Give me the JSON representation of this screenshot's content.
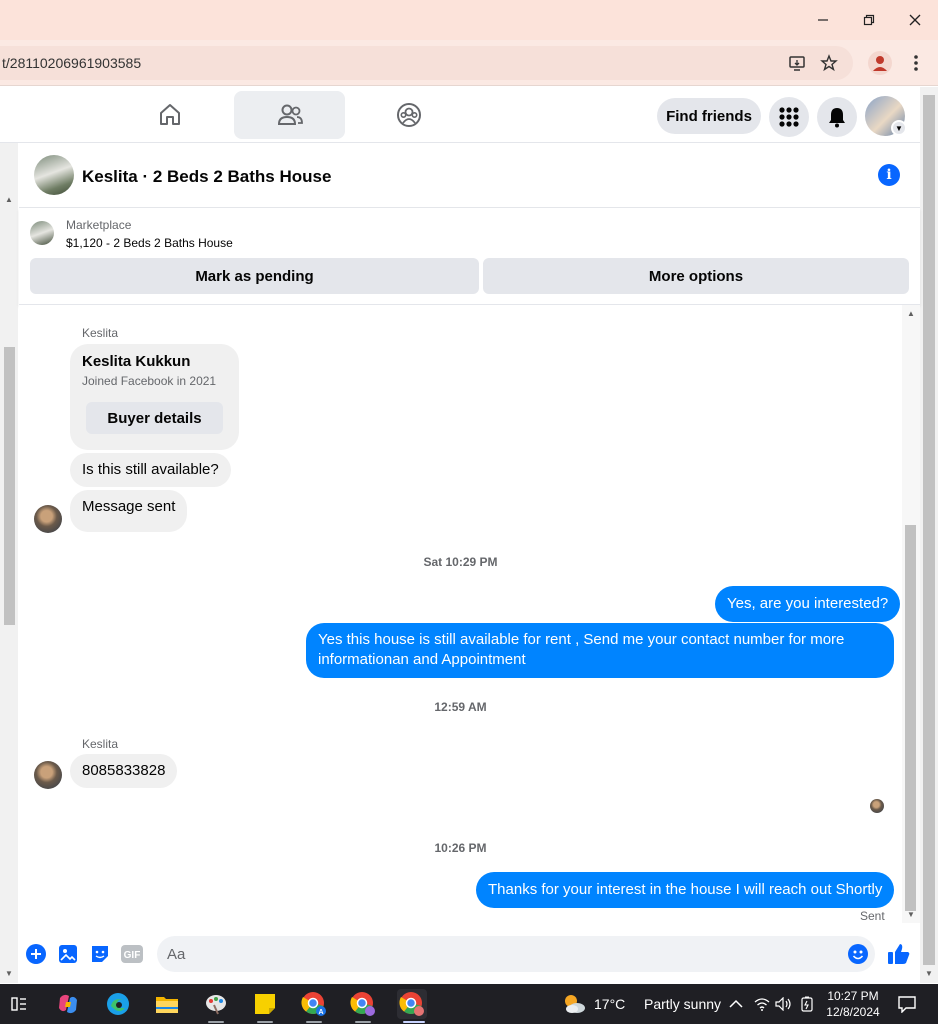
{
  "browser": {
    "url_fragment": "t/28110206961903585",
    "window_controls": {
      "minimize_icon": "minimize-icon",
      "restore_icon": "restore-icon",
      "close_icon": "close-icon"
    }
  },
  "fb_nav": {
    "find_friends_label": "Find friends",
    "active_tab": "friends"
  },
  "chat": {
    "title": "Keslita · 2 Beds 2 Baths House",
    "listing": {
      "kind": "Marketplace",
      "price_line": "$1,120 - 2 Beds 2 Baths House",
      "mark_pending_label": "Mark as pending",
      "more_options_label": "More options"
    },
    "buyer_card": {
      "sender": "Keslita",
      "name": "Keslita Kukkun",
      "joined": "Joined Facebook in 2021",
      "button_label": "Buyer details"
    },
    "messages_1": {
      "still_available": "Is this still available?",
      "message_sent": "Message sent"
    },
    "timestamp_1": "Sat 10:29 PM",
    "outgoing_1": "Yes, are you interested?",
    "outgoing_2": "Yes this house is still available for rent , Send me your contact number for more informationan and Appointment",
    "timestamp_2": "12:59 AM",
    "reply_sender": "Keslita",
    "reply_text": "8085833828",
    "timestamp_3": "10:26 PM",
    "outgoing_3": "Thanks for your interest in the house I will reach out Shortly",
    "sent_status": "Sent",
    "composer_placeholder": "Aa"
  },
  "taskbar": {
    "weather_temp": "17°C",
    "weather_desc": "Partly sunny",
    "time": "10:27 PM",
    "date": "12/8/2024"
  },
  "colors": {
    "accent": "#0084ff",
    "fb_blue": "#0866ff",
    "titlebar": "#fce3da"
  }
}
